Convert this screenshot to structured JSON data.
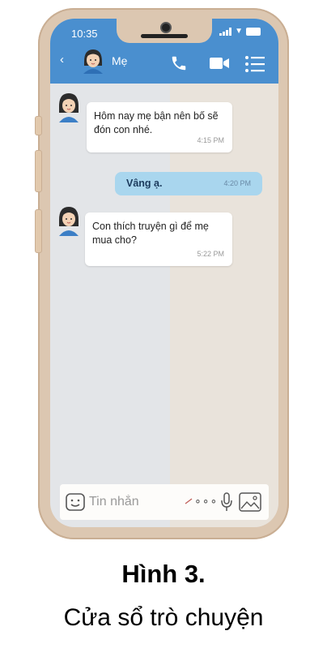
{
  "status_bar": {
    "time": "10:35"
  },
  "header": {
    "contact_name": "Mẹ"
  },
  "messages": [
    {
      "from": "Mẹ",
      "text": "Hôm nay mẹ bận nên bố sẽ đón con nhé.",
      "time": "4:15 PM"
    },
    {
      "from": "me",
      "text": "Vâng ạ.",
      "time": "4:20 PM"
    },
    {
      "from": "Mẹ",
      "text": "Con thích truyện gì để mẹ mua cho?",
      "time": "5:22 PM"
    }
  ],
  "input": {
    "placeholder": "Tin nhắn",
    "more": "∘∘∘"
  },
  "caption": {
    "title": "Hình 3.",
    "subtitle": "Cửa sổ trò chuyện"
  },
  "icons": [
    "back-icon",
    "call-icon",
    "video-icon",
    "menu-icon",
    "emoji-icon",
    "pen-icon",
    "mic-icon",
    "image-icon"
  ],
  "colors": {
    "header": "#4a8fcf",
    "sent_bubble": "#a9d6ee",
    "frame": "#dcc7b1",
    "screen": "#e3e5e8"
  }
}
